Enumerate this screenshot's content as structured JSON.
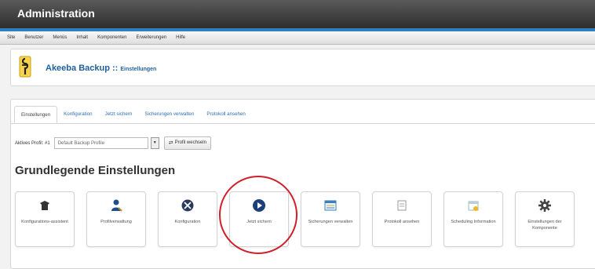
{
  "topbar": {
    "title": "Administration"
  },
  "menu": [
    "Site",
    "Benutzer",
    "Menüs",
    "Inhalt",
    "Komponenten",
    "Erweiterungen",
    "Hilfe"
  ],
  "header": {
    "app_name": "Akeeba Backup",
    "separator": " :: ",
    "section": "Einstellungen"
  },
  "tabs": [
    "Einstellungen",
    "Konfiguration",
    "Jetzt sichern",
    "Sicherungen verwalten",
    "Protokoll ansehen"
  ],
  "profile": {
    "label": "Aktives Profil: #1",
    "selected": "Default Backup Profile",
    "switch_button": "Profil wechseln"
  },
  "heading": "Grundlegende Einstellungen",
  "icons": [
    {
      "icon": "wizard-hat-icon",
      "label": "Konfigurations-assistent"
    },
    {
      "icon": "profile-user-icon",
      "label": "Profilverwaltung"
    },
    {
      "icon": "configuration-icon",
      "label": "Konfiguration"
    },
    {
      "icon": "play-icon",
      "label": "Jetzt sichern"
    },
    {
      "icon": "manage-backups-icon",
      "label": "Sicherungen verwalten"
    },
    {
      "icon": "view-log-icon",
      "label": "Protokoll ansehen"
    },
    {
      "icon": "scheduling-icon",
      "label": "Scheduling Information"
    },
    {
      "icon": "gear-icon",
      "label": "Einstellungen der Komponente"
    }
  ],
  "colors": {
    "accent": "#2e7fc2",
    "link": "#2a6fb5",
    "highlight": "#d01f2b"
  }
}
